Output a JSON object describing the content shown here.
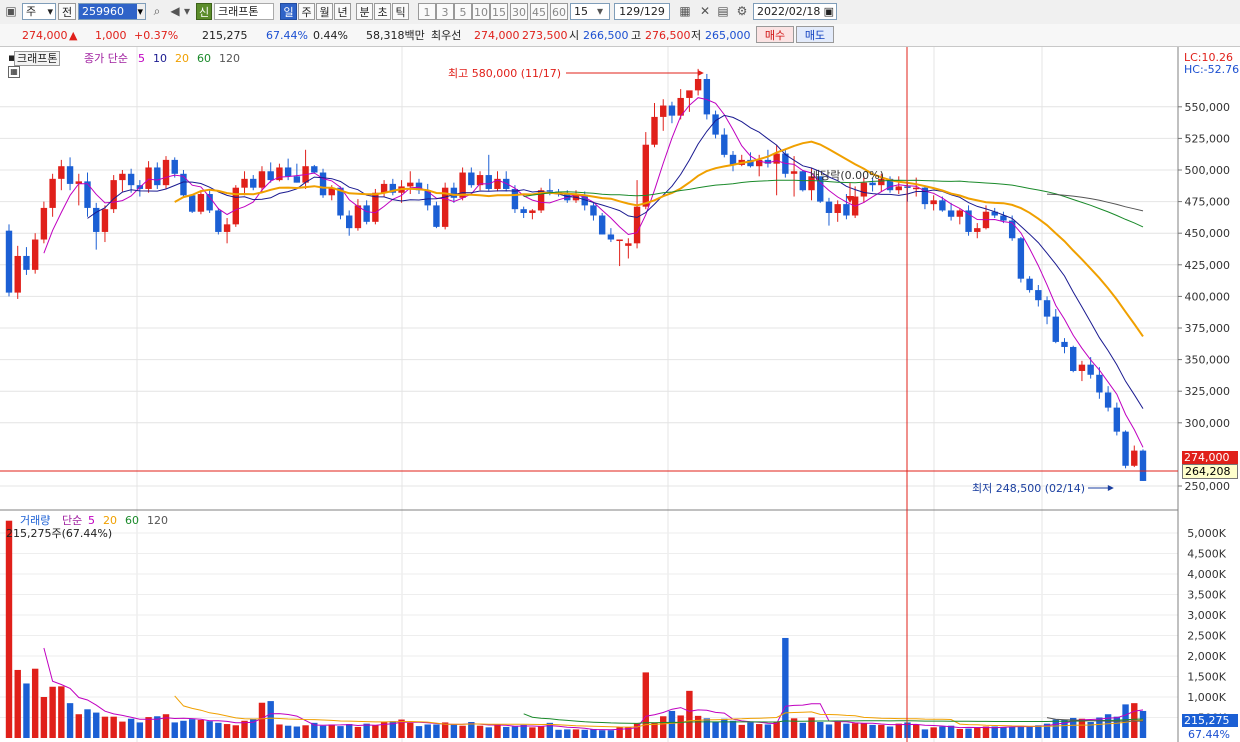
{
  "toolbar": {
    "period_select": "주",
    "prev_label": "전",
    "code_value": "259960",
    "new_badge": "신",
    "stock_name": "크래프톤",
    "timeframes": [
      "일",
      "주",
      "월",
      "년",
      "분",
      "초",
      "틱"
    ],
    "active_timeframe": "일",
    "intervals": [
      "1",
      "3",
      "5",
      "10",
      "15",
      "30",
      "45",
      "60"
    ],
    "interval_value": "15",
    "count_value": "129/129",
    "date_value": "2022/02/18"
  },
  "quote": {
    "price": "274,000",
    "change_arrow": "▲",
    "change": "1,000",
    "change_pct": "+0.37%",
    "volume": "215,275",
    "turnover_pct": "67.44%",
    "ratio": "0.44%",
    "amount": "58,318백만",
    "bid_label": "최우선",
    "ask_price": "274,000",
    "bid_price": "273,500",
    "open_label": "시",
    "open": "266,500",
    "high_label": "고",
    "high": "276,500",
    "low_label": "저",
    "low": "265,000",
    "buy_label": "매수",
    "sell_label": "매도"
  },
  "price_panel": {
    "stock_tag": "크래프톤",
    "legend_prefix": "종가 단순",
    "ma_periods": [
      "5",
      "10",
      "20",
      "60",
      "120"
    ],
    "ma_colors": [
      "#c000c0",
      "#1a1a90",
      "#f0a000",
      "#1a8a2a",
      "#555555"
    ],
    "lc_label": "LC:10.26",
    "hc_label": "HC:-52.76",
    "max_annotation": "최고 580,000 (11/17)",
    "min_annotation": "최저 248,500 (02/14)",
    "dividend_annotation": "배당락(0.00%)",
    "current_price_tag": "274,000",
    "crosshair_price_tag": "264,208",
    "y_ticks": [
      "550,000",
      "525,000",
      "500,000",
      "475,000",
      "450,000",
      "425,000",
      "400,000",
      "375,000",
      "350,000",
      "325,000",
      "300,000",
      "250,000"
    ]
  },
  "volume_panel": {
    "label": "거래량",
    "legend_prefix": "단순",
    "ma_periods": [
      "5",
      "20",
      "60",
      "120"
    ],
    "value_label": "215,275주(67.44%)",
    "current_tag": "215,275",
    "pct_tag": "67.44%",
    "y_ticks": [
      "5,000K",
      "4,500K",
      "4,000K",
      "3,500K",
      "3,000K",
      "2,500K",
      "2,000K",
      "1,500K",
      "1,000K",
      "500K"
    ]
  },
  "chart_data": {
    "type": "candlestick",
    "up_color": "#e0201a",
    "down_color": "#1b5fd4",
    "price_axis_range": [
      240000,
      580000
    ],
    "volume_axis_range_k": [
      0,
      5300
    ],
    "grid": true,
    "ohlc": [
      [
        452000,
        457000,
        400000,
        403000
      ],
      [
        403000,
        440000,
        398000,
        432000
      ],
      [
        432000,
        439000,
        417000,
        421000
      ],
      [
        421000,
        450000,
        418000,
        445000
      ],
      [
        445000,
        475000,
        442000,
        470000
      ],
      [
        470000,
        497000,
        463000,
        493000
      ],
      [
        493000,
        508000,
        484000,
        503000
      ],
      [
        503000,
        510000,
        484000,
        489000
      ],
      [
        489000,
        497000,
        472000,
        491000
      ],
      [
        491000,
        498000,
        463000,
        470000
      ],
      [
        470000,
        474000,
        437000,
        451000
      ],
      [
        451000,
        472000,
        443000,
        469000
      ],
      [
        469000,
        496000,
        466000,
        492000
      ],
      [
        492000,
        500000,
        483000,
        497000
      ],
      [
        497000,
        501000,
        482000,
        488000
      ],
      [
        488000,
        492000,
        479000,
        485000
      ],
      [
        485000,
        507000,
        482000,
        502000
      ],
      [
        502000,
        506000,
        485000,
        488000
      ],
      [
        488000,
        511000,
        485000,
        508000
      ],
      [
        508000,
        510000,
        494000,
        497000
      ],
      [
        497000,
        500000,
        478000,
        480000
      ],
      [
        480000,
        481000,
        466000,
        467000
      ],
      [
        467000,
        484000,
        465000,
        481000
      ],
      [
        481000,
        485000,
        466000,
        468000
      ],
      [
        468000,
        470000,
        449000,
        451000
      ],
      [
        451000,
        462000,
        442000,
        457000
      ],
      [
        457000,
        488000,
        455000,
        486000
      ],
      [
        486000,
        499000,
        480000,
        493000
      ],
      [
        493000,
        496000,
        484000,
        486000
      ],
      [
        486000,
        503000,
        483000,
        499000
      ],
      [
        499000,
        506000,
        490000,
        492000
      ],
      [
        492000,
        505000,
        491000,
        502000
      ],
      [
        502000,
        509000,
        492000,
        495000
      ],
      [
        495000,
        505000,
        490000,
        490000
      ],
      [
        490000,
        516000,
        485000,
        503000
      ],
      [
        503000,
        504000,
        497000,
        498000
      ],
      [
        498000,
        501000,
        478000,
        480000
      ],
      [
        480000,
        488000,
        476000,
        486000
      ],
      [
        486000,
        487000,
        461000,
        464000
      ],
      [
        464000,
        468000,
        448000,
        454000
      ],
      [
        454000,
        477000,
        452000,
        472000
      ],
      [
        472000,
        476000,
        457000,
        459000
      ],
      [
        459000,
        485000,
        457000,
        482000
      ],
      [
        482000,
        492000,
        479000,
        489000
      ],
      [
        489000,
        493000,
        480000,
        482000
      ],
      [
        482000,
        492000,
        474000,
        487000
      ],
      [
        487000,
        499000,
        481000,
        490000
      ],
      [
        490000,
        493000,
        481000,
        484000
      ],
      [
        484000,
        489000,
        468000,
        472000
      ],
      [
        472000,
        475000,
        454000,
        455000
      ],
      [
        455000,
        490000,
        453000,
        486000
      ],
      [
        486000,
        490000,
        474000,
        478000
      ],
      [
        478000,
        502000,
        476000,
        498000
      ],
      [
        498000,
        502000,
        486000,
        488000
      ],
      [
        488000,
        499000,
        484000,
        496000
      ],
      [
        496000,
        512000,
        483000,
        485000
      ],
      [
        485000,
        499000,
        483000,
        493000
      ],
      [
        493000,
        499000,
        483000,
        485000
      ],
      [
        485000,
        488000,
        466000,
        469000
      ],
      [
        469000,
        471000,
        462000,
        466000
      ],
      [
        466000,
        469000,
        461000,
        468000
      ],
      [
        468000,
        486000,
        466000,
        484000
      ],
      [
        484000,
        493000,
        480000,
        483000
      ],
      [
        483000,
        485000,
        479000,
        481000
      ],
      [
        481000,
        484000,
        474000,
        476000
      ],
      [
        476000,
        484000,
        474000,
        480000
      ],
      [
        480000,
        483000,
        468000,
        472000
      ],
      [
        472000,
        474000,
        460000,
        464000
      ],
      [
        464000,
        466000,
        449000,
        449000
      ],
      [
        449000,
        454000,
        443000,
        445000
      ],
      [
        445000,
        445000,
        424000,
        445000
      ],
      [
        440000,
        446000,
        430000,
        442000
      ],
      [
        442000,
        492000,
        438000,
        471000
      ],
      [
        471000,
        530000,
        469000,
        520000
      ],
      [
        520000,
        553000,
        518000,
        542000
      ],
      [
        542000,
        556000,
        531000,
        551000
      ],
      [
        551000,
        554000,
        537000,
        543000
      ],
      [
        543000,
        564000,
        540000,
        557000
      ],
      [
        557000,
        562000,
        546000,
        563000
      ],
      [
        563000,
        580000,
        559000,
        572000
      ],
      [
        572000,
        576000,
        540000,
        544000
      ],
      [
        544000,
        547000,
        525000,
        528000
      ],
      [
        528000,
        533000,
        510000,
        512000
      ],
      [
        512000,
        515000,
        499000,
        504000
      ],
      [
        504000,
        512000,
        503000,
        508000
      ],
      [
        508000,
        514000,
        502000,
        503000
      ],
      [
        503000,
        512000,
        495000,
        508000
      ],
      [
        508000,
        516000,
        502000,
        505000
      ],
      [
        505000,
        520000,
        480000,
        513000
      ],
      [
        513000,
        516000,
        494000,
        497000
      ],
      [
        497000,
        511000,
        479000,
        499000
      ],
      [
        499000,
        500000,
        483000,
        484000
      ],
      [
        484000,
        502000,
        476000,
        495000
      ],
      [
        495000,
        495000,
        474000,
        475000
      ],
      [
        475000,
        478000,
        456000,
        466000
      ],
      [
        466000,
        476000,
        459000,
        473000
      ],
      [
        473000,
        481000,
        461000,
        464000
      ],
      [
        464000,
        487000,
        462000,
        479000
      ],
      [
        479000,
        495000,
        474000,
        490000
      ],
      [
        490000,
        494000,
        483000,
        488000
      ],
      [
        488000,
        497000,
        483000,
        493000
      ],
      [
        493000,
        495000,
        482000,
        484000
      ],
      [
        484000,
        495000,
        481000,
        487000
      ],
      [
        487000,
        491000,
        475000,
        486000
      ],
      [
        486000,
        494000,
        479000,
        486000
      ],
      [
        486000,
        487000,
        469000,
        473000
      ],
      [
        473000,
        480000,
        468000,
        476000
      ],
      [
        476000,
        479000,
        467000,
        468000
      ],
      [
        468000,
        474000,
        460000,
        463000
      ],
      [
        463000,
        469000,
        457000,
        468000
      ],
      [
        468000,
        472000,
        448000,
        451000
      ],
      [
        451000,
        458000,
        446000,
        454000
      ],
      [
        454000,
        472000,
        453000,
        467000
      ],
      [
        467000,
        470000,
        462000,
        464000
      ],
      [
        464000,
        467000,
        458000,
        460000
      ],
      [
        460000,
        464000,
        444000,
        446000
      ],
      [
        446000,
        447000,
        411000,
        414000
      ],
      [
        414000,
        416000,
        403000,
        405000
      ],
      [
        405000,
        409000,
        392000,
        397000
      ],
      [
        397000,
        400000,
        378000,
        384000
      ],
      [
        384000,
        390000,
        363000,
        364000
      ],
      [
        364000,
        367000,
        355000,
        360000
      ],
      [
        360000,
        361000,
        340000,
        341000
      ],
      [
        341000,
        349000,
        333000,
        346000
      ],
      [
        346000,
        352000,
        335000,
        338000
      ],
      [
        338000,
        344000,
        319000,
        324000
      ],
      [
        324000,
        329000,
        309000,
        312000
      ],
      [
        312000,
        316000,
        290000,
        293000
      ],
      [
        293000,
        294000,
        264000,
        266000
      ],
      [
        266000,
        282000,
        265000,
        278000
      ],
      [
        278000,
        279000,
        254000,
        254000
      ]
    ],
    "volume_k": [
      5300,
      1660,
      1330,
      1690,
      1000,
      1250,
      1260,
      850,
      580,
      700,
      620,
      520,
      520,
      400,
      470,
      380,
      510,
      530,
      580,
      380,
      420,
      460,
      440,
      410,
      370,
      340,
      310,
      420,
      470,
      860,
      900,
      330,
      300,
      280,
      310,
      370,
      300,
      330,
      290,
      340,
      270,
      350,
      310,
      390,
      410,
      450,
      370,
      290,
      330,
      330,
      380,
      330,
      300,
      390,
      300,
      260,
      330,
      270,
      280,
      320,
      260,
      280,
      370,
      200,
      210,
      210,
      200,
      220,
      190,
      190,
      260,
      260,
      350,
      1600,
      370,
      530,
      660,
      550,
      1150,
      540,
      480,
      400,
      470,
      420,
      320,
      380,
      340,
      330,
      390,
      2440,
      480,
      370,
      500,
      390,
      330,
      410,
      350,
      360,
      360,
      320,
      320,
      280,
      350,
      380,
      330,
      210,
      260,
      280,
      300,
      220,
      230,
      250,
      280,
      280,
      260,
      280,
      300,
      270,
      310,
      350,
      450,
      450,
      490,
      470,
      390,
      500,
      580,
      520,
      820,
      850,
      660
    ],
    "volume_up": [
      true,
      true,
      false,
      true,
      true,
      true,
      true,
      false,
      true,
      false,
      false,
      true,
      true,
      true,
      false,
      false,
      true,
      false,
      true,
      false,
      false,
      false,
      true,
      false,
      false,
      true,
      true,
      true,
      false,
      true,
      false,
      true,
      false,
      false,
      true,
      false,
      false,
      true,
      false,
      false,
      true,
      false,
      true,
      true,
      false,
      true,
      true,
      false,
      false,
      false,
      true,
      false,
      true,
      false,
      true,
      false,
      true,
      false,
      false,
      false,
      true,
      true,
      false,
      false,
      false,
      true,
      false,
      false,
      false,
      false,
      true,
      true,
      true,
      true,
      true,
      true,
      false,
      true,
      true,
      true,
      false,
      false,
      false,
      false,
      true,
      false,
      true,
      false,
      true,
      false,
      true,
      false,
      true,
      false,
      false,
      true,
      false,
      true,
      true,
      false,
      true,
      false,
      true,
      false,
      true,
      false,
      true,
      false,
      false,
      true,
      false,
      true,
      true,
      false,
      false,
      false,
      false,
      false,
      false,
      false,
      false,
      false,
      false,
      true,
      false,
      false,
      false,
      false,
      false,
      true,
      false
    ]
  }
}
